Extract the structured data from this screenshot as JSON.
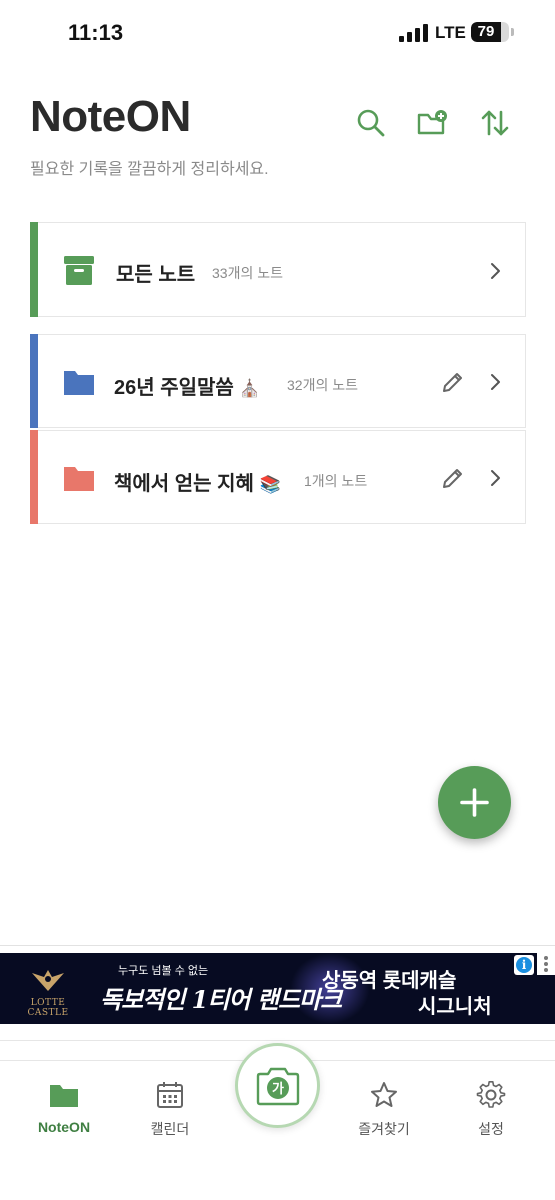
{
  "status_bar": {
    "time": "11:13",
    "network": "LTE",
    "battery_level": "79",
    "battery_fraction": 0.79
  },
  "header": {
    "title": "NoteON",
    "subtitle": "필요한 기록을 깔끔하게 정리하세요.",
    "icons": [
      "search-icon",
      "folder-add-icon",
      "sort-icon"
    ],
    "accent_color": "#579c58"
  },
  "folders": [
    {
      "name": "모든 노트",
      "emoji": "",
      "count": "33개의 노트",
      "color": "#579c58",
      "icon": "archive-icon",
      "editable": false
    },
    {
      "name": "26년 주일말씀",
      "emoji": "⛪",
      "count": "32개의 노트",
      "color": "#4a74bd",
      "icon": "folder-icon",
      "editable": true
    },
    {
      "name": "책에서 얻는 지혜",
      "emoji": "📚",
      "count": "1개의 노트",
      "color": "#e8776a",
      "icon": "folder-icon",
      "editable": true
    }
  ],
  "fab": {
    "icon": "plus-icon"
  },
  "ad": {
    "brand_logo": "LOTTE CASTLE",
    "small_text": "누구도 넘볼 수 없는",
    "script_text": "독보적인 1티어 랜드마크",
    "headline_line1": "상동역 롯데캐슬",
    "headline_line2": "시그니처",
    "info_glyph": "i"
  },
  "bottom_nav": {
    "items": [
      {
        "label": "NoteON",
        "icon": "folder-icon",
        "active": true
      },
      {
        "label": "캘린더",
        "icon": "calendar-icon",
        "active": false
      },
      {
        "label": "즐겨찾기",
        "icon": "star-icon",
        "active": false
      },
      {
        "label": "설정",
        "icon": "gear-icon",
        "active": false
      }
    ],
    "camera": {
      "glyph": "가",
      "icon": "camera-text-icon"
    }
  }
}
